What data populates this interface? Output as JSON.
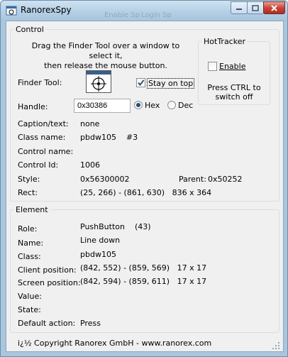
{
  "window": {
    "title": "RanorexSpy",
    "ghost_title_1": "Enable Sp",
    "ghost_title_2": "Login Sp"
  },
  "control": {
    "legend": "Control",
    "instruction": "Drag the Finder Tool over a window to select it,\nthen release the mouse button.",
    "finder_tool_label": "Finder Tool:",
    "stay_on_top_label": "Stay on top",
    "stay_on_top_checked": true,
    "handle_label": "Handle:",
    "handle_value": "0x30386",
    "hex_label": "Hex",
    "dec_label": "Dec",
    "radix_selected": "hex",
    "caption_label": "Caption/text:",
    "caption_value": "none",
    "classname_label": "Class name:",
    "classname_value": "pbdw105    #3",
    "controlname_label": "Control name:",
    "controlname_value": "",
    "controlid_label": "Control Id:",
    "controlid_value": "1006",
    "style_label": "Style:",
    "style_value": "0x56300002",
    "parent_label": "Parent:",
    "parent_value": "0x50252",
    "rect_label": "Rect:",
    "rect_value": "(25, 266) - (861, 630)   836 x 364"
  },
  "hottracker": {
    "legend": "HotTracker",
    "enable_label": "Enable",
    "enable_checked": false,
    "hint": "Press CTRL to\nswitch off"
  },
  "element": {
    "legend": "Element",
    "role_label": "Role:",
    "role_value": "PushButton    (43)",
    "name_label": "Name:",
    "name_value": "Line down",
    "class_label": "Class:",
    "class_value": "pbdw105",
    "clientpos_label": "Client position:",
    "clientpos_value": "(842, 552) - (859, 569)   17 x 17",
    "screenpos_label": "Screen position:",
    "screenpos_value": "(842, 594) - (859, 611)   17 x 17",
    "value_label": "Value:",
    "value_value": "",
    "state_label": "State:",
    "state_value": "",
    "defaction_label": "Default action:",
    "defaction_value": "Press"
  },
  "status": {
    "copyright": "i¿½ Copyright Ranorex GmbH - www.ranorex.com"
  }
}
